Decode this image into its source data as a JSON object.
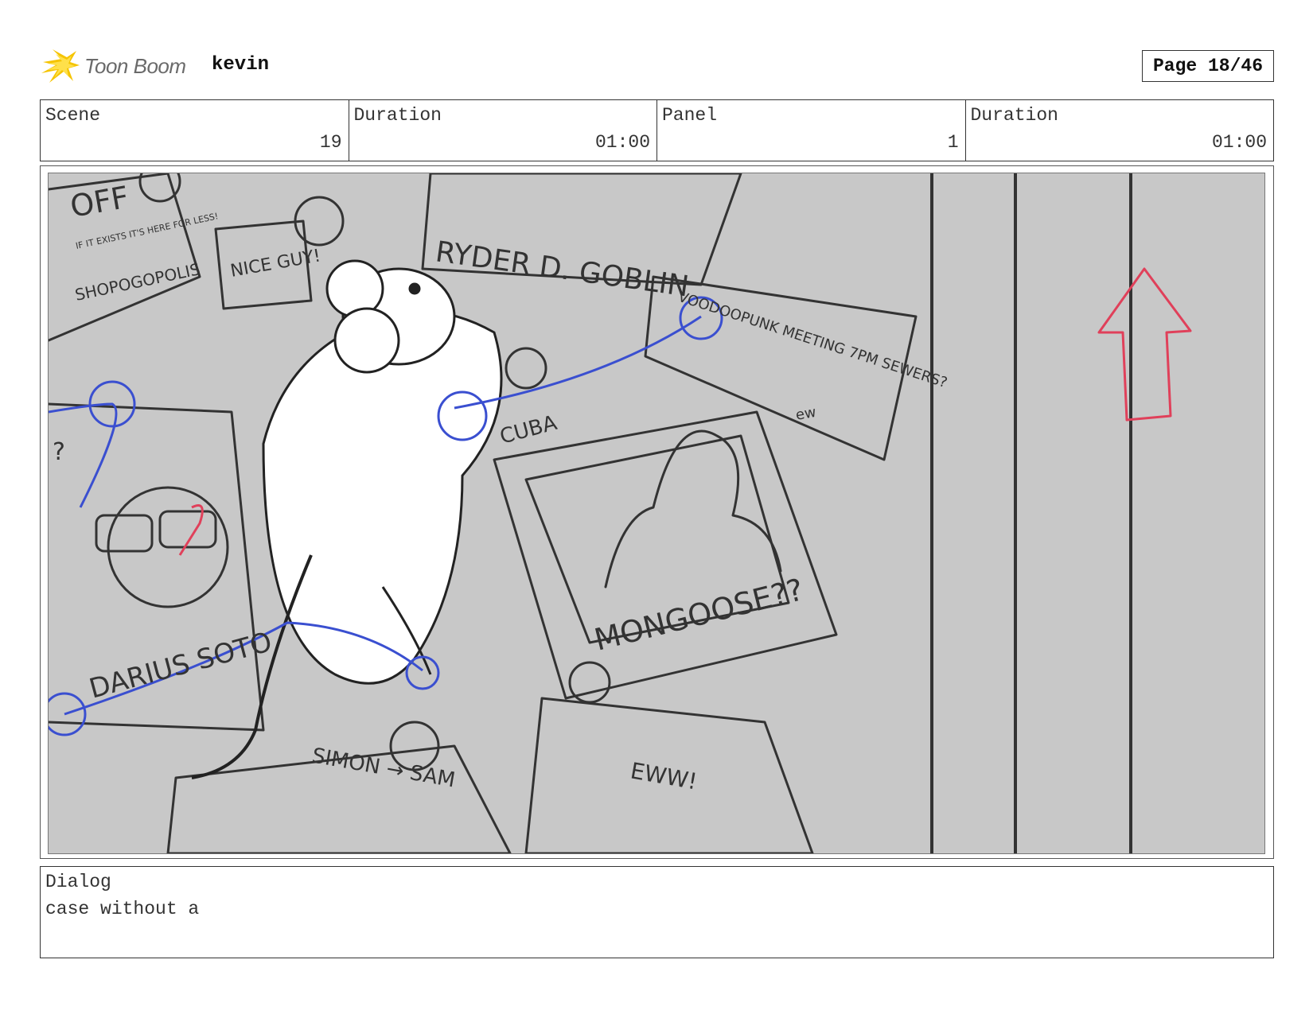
{
  "header": {
    "logo_text": "Toon Boom",
    "user": "kevin",
    "page_label": "Page 18/46"
  },
  "info": {
    "scene_label": "Scene",
    "scene_value": "19",
    "scene_duration_label": "Duration",
    "scene_duration_value": "01:00",
    "panel_label": "Panel",
    "panel_value": "1",
    "panel_duration_label": "Duration",
    "panel_duration_value": "01:00"
  },
  "panel_image": {
    "background_color": "#c8c8c8",
    "line_color": "#333333",
    "string_color": "#3a4fd0",
    "arrow_color": "#e0405a",
    "sketch_texts": {
      "off": "OFF",
      "if_it_exists": "IF IT EXISTS IT'S HERE FOR LESS!",
      "shopogopolis": "SHOPOGOPOLIS",
      "nice_guy": "NICE GUY!",
      "ryder": "RYDER D. GOBLIN",
      "voodoo": "VOODOOPUNK MEETING 7PM SEWERS?",
      "ew": "ew",
      "cuba": "CUBA",
      "mongoose": "MONGOOSE??",
      "darius": "DARIUS SOTO",
      "simon": "SIMON → SAM",
      "eww": "EWW!",
      "question": "?"
    }
  },
  "dialog": {
    "label": "Dialog",
    "text": "case without a"
  }
}
